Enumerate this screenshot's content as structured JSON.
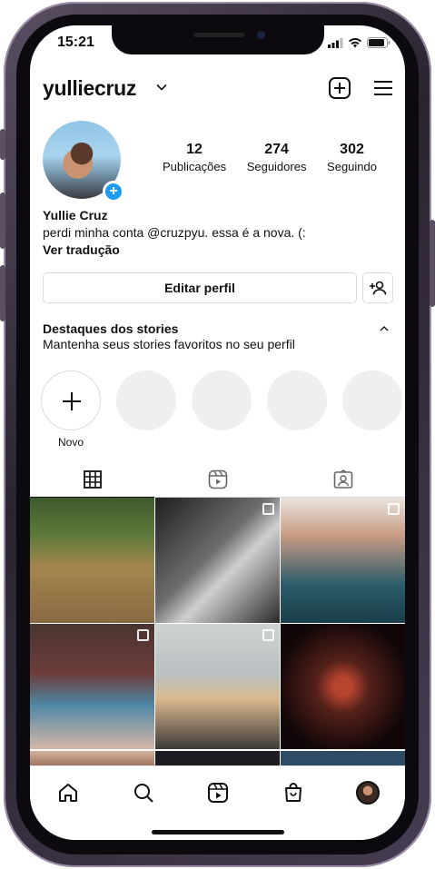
{
  "status_bar": {
    "time": "15:21"
  },
  "header": {
    "username": "yulliecruz"
  },
  "profile": {
    "stats": [
      {
        "value": "12",
        "label": "Publicações"
      },
      {
        "value": "274",
        "label": "Seguidores"
      },
      {
        "value": "302",
        "label": "Seguindo"
      }
    ],
    "name": "Yullie Cruz",
    "bio": "perdi minha conta @cruzpyu. essa é a nova. (:",
    "translate": "Ver tradução"
  },
  "actions": {
    "edit_profile": "Editar perfil"
  },
  "highlights": {
    "title": "Destaques dos stories",
    "subtitle": "Mantenha seus stories favoritos no seu perfil",
    "new_label": "Novo"
  },
  "tabs": [
    "grid-icon",
    "reels-icon",
    "tagged-icon"
  ],
  "nav": [
    "home-icon",
    "search-icon",
    "reels-icon",
    "shop-icon",
    "profile-avatar"
  ]
}
